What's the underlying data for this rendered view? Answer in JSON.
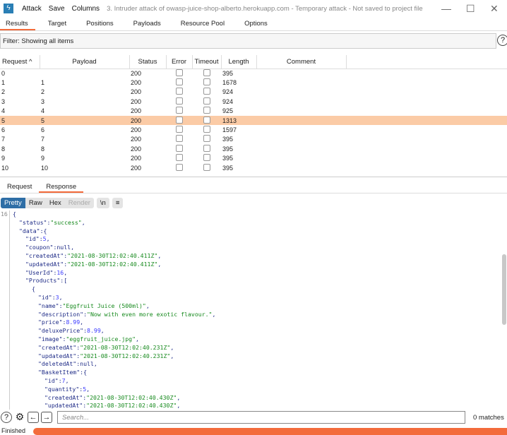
{
  "window": {
    "title": "3. Intruder attack of owasp-juice-shop-alberto.herokuapp.com - Temporary attack - Not saved to project file",
    "menu": [
      "Attack",
      "Save",
      "Columns"
    ],
    "logo": "burp-logo"
  },
  "tabs": [
    "Results",
    "Target",
    "Positions",
    "Payloads",
    "Resource Pool",
    "Options"
  ],
  "filter": "Filter: Showing all items",
  "table": {
    "headers": [
      "Request ^",
      "Payload",
      "Status",
      "Error",
      "Timeout",
      "Length",
      "Comment"
    ],
    "rows": [
      [
        "0",
        "",
        "200",
        "395"
      ],
      [
        "1",
        "1",
        "200",
        "1678"
      ],
      [
        "2",
        "2",
        "200",
        "924"
      ],
      [
        "3",
        "3",
        "200",
        "924"
      ],
      [
        "4",
        "4",
        "200",
        "925"
      ],
      [
        "5",
        "5",
        "200",
        "1313"
      ],
      [
        "6",
        "6",
        "200",
        "1597"
      ],
      [
        "7",
        "7",
        "200",
        "395"
      ],
      [
        "8",
        "8",
        "200",
        "395"
      ],
      [
        "9",
        "9",
        "200",
        "395"
      ],
      [
        "10",
        "10",
        "200",
        "395"
      ]
    ],
    "selected_row": 5
  },
  "response_tabs": [
    "Request",
    "Response"
  ],
  "view_buttons": [
    "Pretty",
    "Raw",
    "Hex",
    "Render",
    "\\n",
    "≡"
  ],
  "code": {
    "line_number": "16",
    "lines": [
      {
        "i": 0,
        "p": "{"
      },
      {
        "i": 1,
        "k": "\"status\"",
        "s": "\"success\"",
        "p": ","
      },
      {
        "i": 1,
        "k": "\"data\"",
        "p": ":{"
      },
      {
        "i": 2,
        "k": "\"id\"",
        "n": "5",
        "p": ","
      },
      {
        "i": 2,
        "k": "\"coupon\"",
        "v": "null",
        "p": ","
      },
      {
        "i": 2,
        "k": "\"createdAt\"",
        "s": "\"2021-08-30T12:02:40.411Z\"",
        "p": ","
      },
      {
        "i": 2,
        "k": "\"updatedAt\"",
        "s": "\"2021-08-30T12:02:40.411Z\"",
        "p": ","
      },
      {
        "i": 2,
        "k": "\"UserId\"",
        "n": "16",
        "p": ","
      },
      {
        "i": 2,
        "k": "\"Products\"",
        "p": ":["
      },
      {
        "i": 3,
        "p": "{"
      },
      {
        "i": 4,
        "k": "\"id\"",
        "n": "3",
        "p": ","
      },
      {
        "i": 4,
        "k": "\"name\"",
        "s": "\"Eggfruit Juice (500ml)\"",
        "p": ","
      },
      {
        "i": 4,
        "k": "\"description\"",
        "s": "\"Now with even more exotic flavour.\"",
        "p": ","
      },
      {
        "i": 4,
        "k": "\"price\"",
        "n": "8.99",
        "p": ","
      },
      {
        "i": 4,
        "k": "\"deluxePrice\"",
        "n": "8.99",
        "p": ","
      },
      {
        "i": 4,
        "k": "\"image\"",
        "s": "\"eggfruit_juice.jpg\"",
        "p": ","
      },
      {
        "i": 4,
        "k": "\"createdAt\"",
        "s": "\"2021-08-30T12:02:40.231Z\"",
        "p": ","
      },
      {
        "i": 4,
        "k": "\"updatedAt\"",
        "s": "\"2021-08-30T12:02:40.231Z\"",
        "p": ","
      },
      {
        "i": 4,
        "k": "\"deletedAt\"",
        "v": "null",
        "p": ","
      },
      {
        "i": 4,
        "k": "\"BasketItem\"",
        "p": ":{"
      },
      {
        "i": 5,
        "k": "\"id\"",
        "n": "7",
        "p": ","
      },
      {
        "i": 5,
        "k": "\"quantity\"",
        "n": "5",
        "p": ","
      },
      {
        "i": 5,
        "k": "\"createdAt\"",
        "s": "\"2021-08-30T12:02:40.430Z\"",
        "p": ","
      },
      {
        "i": 5,
        "k": "\"updatedAt\"",
        "s": "\"2021-08-30T12:02:40.430Z\"",
        "p": ","
      }
    ]
  },
  "search": {
    "placeholder": "Search...",
    "matches": "0 matches"
  },
  "status": {
    "text": "Finished",
    "progress": 1.0
  },
  "colors": {
    "accent": "#f36b3b",
    "selected_row": "#fbcba6",
    "pretty_active": "#2e6ea6"
  }
}
